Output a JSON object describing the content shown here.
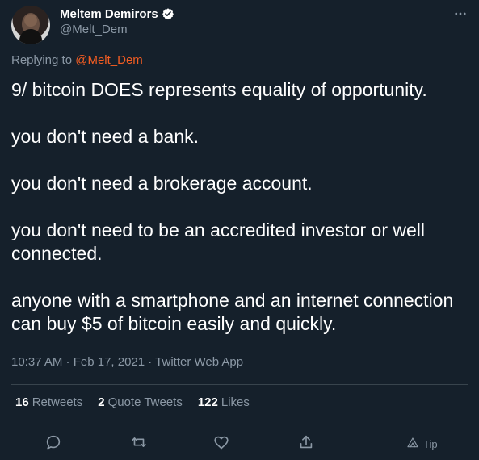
{
  "theme": {
    "background": "#15202b",
    "primary_text": "#ffffff",
    "secondary_text": "#8b98a5",
    "accent": "#f45d22",
    "divider": "#38444d"
  },
  "header": {
    "display_name": "Meltem Demirors",
    "handle": "@Melt_Dem",
    "verified_icon": "verified-badge-icon",
    "more_icon": "more-horizontal-icon"
  },
  "reply_context": {
    "prefix": "Replying to",
    "handle": "@Melt_Dem"
  },
  "tweet": {
    "text": "9/ bitcoin DOES represents equality of opportunity.\n\nyou don't need a bank.\n\nyou don't need a brokerage account.\n\nyou don't need to be an accredited investor or well connected.\n\nanyone with a smartphone and an internet connection can buy $5 of bitcoin easily and quickly.",
    "timestamp": "10:37 AM · Feb 17, 2021 · Twitter Web App"
  },
  "stats": {
    "retweets_count": "16",
    "retweets_label": "Retweets",
    "quote_count": "2",
    "quote_label": "Quote Tweets",
    "likes_count": "122",
    "likes_label": "Likes"
  },
  "actions": {
    "reply_icon": "reply-icon",
    "retweet_icon": "retweet-icon",
    "like_icon": "heart-icon",
    "share_icon": "share-icon",
    "tip_icon": "tip-icon",
    "tip_label": "Tip"
  }
}
